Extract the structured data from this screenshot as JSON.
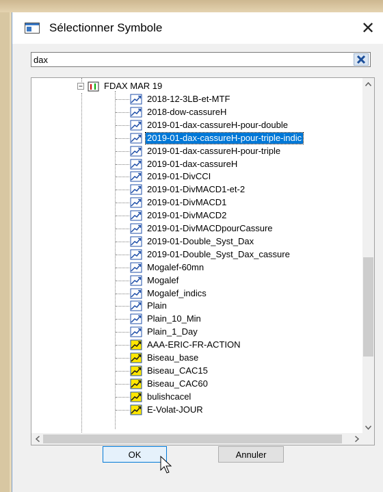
{
  "window": {
    "title": "Sélectionner Symbole",
    "close_label": "✕"
  },
  "search": {
    "value": "dax"
  },
  "tree": {
    "parent": {
      "label": "FDAX MAR 19",
      "expander": "⊟"
    },
    "items": [
      {
        "label": "2018-12-3LB-et-MTF",
        "icon": "chart-icon-blue"
      },
      {
        "label": "2018-dow-cassureH",
        "icon": "chart-icon-blue"
      },
      {
        "label": "2019-01-dax-cassureH-pour-double",
        "icon": "chart-icon-blue"
      },
      {
        "label": "2019-01-dax-cassureH-pour-triple-indic",
        "icon": "chart-icon-blue",
        "selected": true
      },
      {
        "label": "2019-01-dax-cassureH-pour-triple",
        "icon": "chart-icon-blue"
      },
      {
        "label": "2019-01-dax-cassureH",
        "icon": "chart-icon-blue"
      },
      {
        "label": "2019-01-DivCCI",
        "icon": "chart-icon-blue"
      },
      {
        "label": "2019-01-DivMACD1-et-2",
        "icon": "chart-icon-blue"
      },
      {
        "label": "2019-01-DivMACD1",
        "icon": "chart-icon-blue"
      },
      {
        "label": "2019-01-DivMACD2",
        "icon": "chart-icon-blue"
      },
      {
        "label": "2019-01-DivMACDpourCassure",
        "icon": "chart-icon-blue"
      },
      {
        "label": "2019-01-Double_Syst_Dax",
        "icon": "chart-icon-blue"
      },
      {
        "label": "2019-01-Double_Syst_Dax_cassure",
        "icon": "chart-icon-blue"
      },
      {
        "label": "Mogalef-60mn",
        "icon": "chart-icon-blue"
      },
      {
        "label": "Mogalef",
        "icon": "chart-icon-blue"
      },
      {
        "label": "Mogalef_indics",
        "icon": "chart-icon-blue"
      },
      {
        "label": "Plain",
        "icon": "chart-icon-blue"
      },
      {
        "label": "Plain_10_Min",
        "icon": "chart-icon-blue"
      },
      {
        "label": "Plain_1_Day",
        "icon": "chart-icon-blue"
      },
      {
        "label": "AAA-ERIC-FR-ACTION",
        "icon": "chart-icon-yellow"
      },
      {
        "label": "Biseau_base",
        "icon": "chart-icon-yellow"
      },
      {
        "label": "Biseau_CAC15",
        "icon": "chart-icon-yellow"
      },
      {
        "label": "Biseau_CAC60",
        "icon": "chart-icon-yellow"
      },
      {
        "label": "bulishcacel",
        "icon": "chart-icon-yellow"
      },
      {
        "label": "E-Volat-JOUR",
        "icon": "chart-icon-yellow"
      }
    ]
  },
  "buttons": {
    "ok": "OK",
    "cancel": "Annuler"
  },
  "colors": {
    "selection": "#0078d7",
    "ok_border": "#0078d7"
  }
}
